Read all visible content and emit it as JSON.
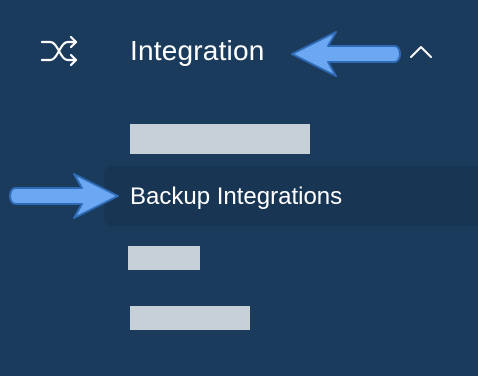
{
  "nav": {
    "section_label": "Integration",
    "section_icon": "shuffle-icon",
    "expanded_icon": "chevron-up-icon"
  },
  "submenu": {
    "active_label": "Backup Integrations"
  },
  "colors": {
    "background": "#1b3b5c",
    "active_background": "#183553",
    "text": "#ffffff",
    "redaction": "#c7cfd8",
    "annotation_arrow": "#6ca8f2"
  }
}
